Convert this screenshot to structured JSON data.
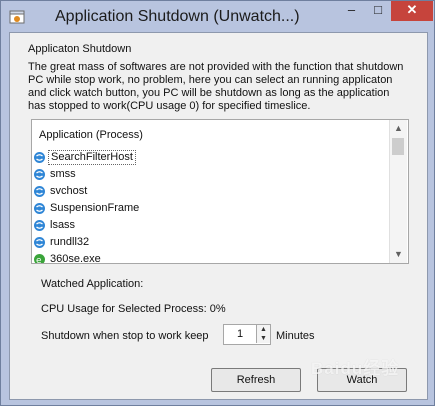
{
  "window": {
    "title": "Application Shutdown (Unwatch...)",
    "min_glyph": "–",
    "max_glyph": "□",
    "close_glyph": "✕",
    "icon": "app-window-icon"
  },
  "group": {
    "label": "Applicaton Shutdown",
    "description": "The great mass of softwares are not provided with the function that shutdown PC while stop work, no problem, here you can select an running applicaton and click watch button, you PC will be shutdown as long as the application has stopped to work(CPU usage 0) for specified timeslice."
  },
  "list": {
    "header": "Application (Process)",
    "items": [
      {
        "label": "SearchFilterHost",
        "icon": "process-icon",
        "selected": true
      },
      {
        "label": "smss",
        "icon": "process-icon"
      },
      {
        "label": "svchost",
        "icon": "process-icon"
      },
      {
        "label": "SuspensionFrame",
        "icon": "process-icon"
      },
      {
        "label": "lsass",
        "icon": "process-icon"
      },
      {
        "label": "rundll32",
        "icon": "process-icon"
      },
      {
        "label": "360se.exe",
        "icon": "browser-icon"
      }
    ]
  },
  "watched": {
    "label": "Watched Application:"
  },
  "cpu": {
    "label": "CPU Usage for Selected Process: 0%"
  },
  "shutdown": {
    "label": "Shutdown when stop to work keep",
    "value": "1",
    "unit": "Minutes"
  },
  "buttons": {
    "refresh": "Refresh",
    "watch": "Watch"
  },
  "watermark": "Baidu经验",
  "colors": {
    "titlebar": "#b8c4df",
    "close": "#c6443c",
    "panel": "#f0f0f0",
    "process_icon": "#2f86d6"
  }
}
